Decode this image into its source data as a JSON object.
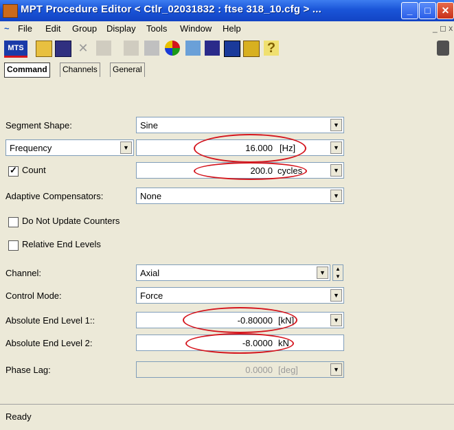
{
  "window": {
    "title": "MPT Procedure Editor  < Ctlr_02031832 : ftse 318_10.cfg > ..."
  },
  "menu": {
    "items": [
      "File",
      "Edit",
      "Group",
      "Display",
      "Tools",
      "Window",
      "Help"
    ]
  },
  "toolbar": {
    "logo": "MTS"
  },
  "tabs": [
    "Command",
    "Channels",
    "General"
  ],
  "form": {
    "segment_shape": {
      "label": "Segment Shape:",
      "value": "Sine"
    },
    "frequency": {
      "mode": "Frequency",
      "value": "16.000",
      "unit": "[Hz]"
    },
    "count": {
      "label": "Count",
      "checked": true,
      "value": "200.0",
      "unit": "cycles"
    },
    "adaptive": {
      "label": "Adaptive Compensators:",
      "value": "None"
    },
    "no_update": {
      "label": "Do Not Update Counters",
      "checked": false
    },
    "relative": {
      "label": "Relative End Levels",
      "checked": false
    },
    "channel": {
      "label": "Channel:",
      "value": "Axial"
    },
    "control_mode": {
      "label": "Control Mode:",
      "value": "Force"
    },
    "abs_end_1": {
      "label": "Absolute End Level 1::",
      "value": "-0.80000",
      "unit": "[kN]"
    },
    "abs_end_2": {
      "label": "Absolute End Level 2:",
      "value": "-8.0000",
      "unit": "kN"
    },
    "phase_lag": {
      "label": "Phase Lag:",
      "value": "0.0000",
      "unit": "[deg]"
    }
  },
  "status": {
    "text": "Ready"
  }
}
